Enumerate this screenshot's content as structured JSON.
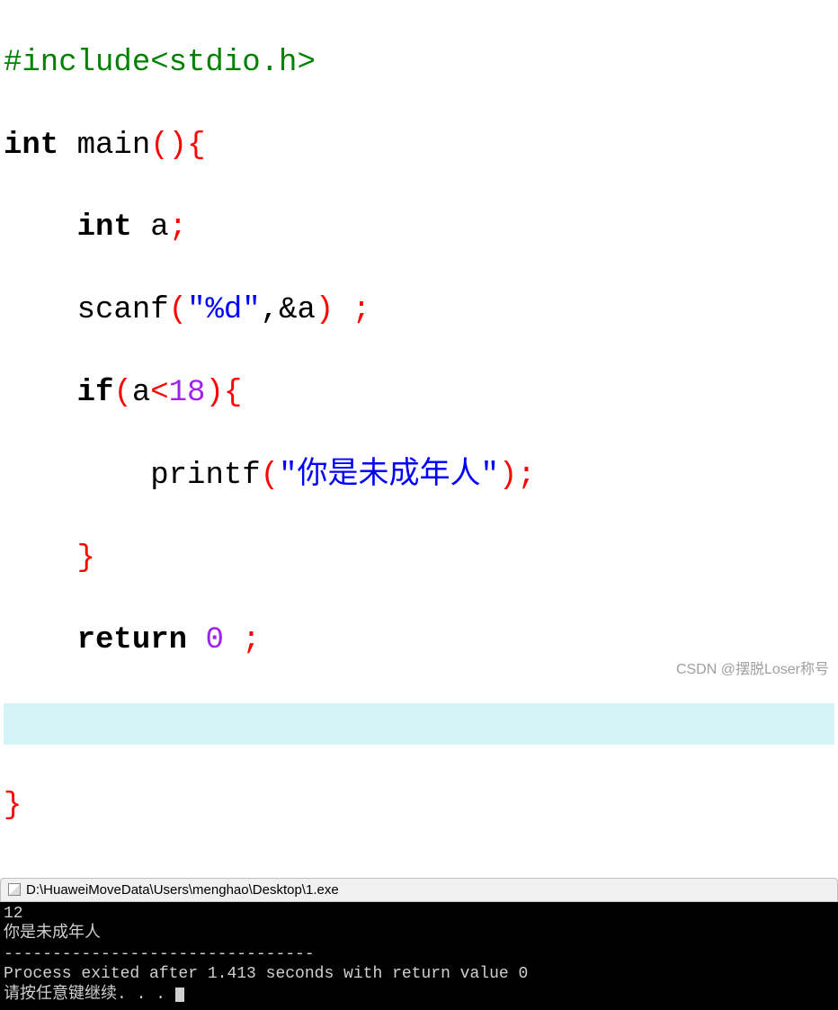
{
  "code": {
    "line1_include": "#include<stdio.h>",
    "line2_int": "int",
    "line2_main": " main",
    "line2_op": "()",
    "line2_brace": "{",
    "line3_indent": "    ",
    "line3_int": "int",
    "line3_a": " a",
    "line3_semi": ";",
    "line4_indent": "    ",
    "line4_scanf": "scanf",
    "line4_op1": "(",
    "line4_str": "\"%d\"",
    "line4_comma": ",",
    "line4_amp": "&a",
    "line4_op2": ")",
    "line4_space": " ",
    "line4_semi": ";",
    "line5_indent": "    ",
    "line5_if": "if",
    "line5_op1": "(",
    "line5_a": "a",
    "line5_lt": "<",
    "line5_num": "18",
    "line5_op2": ")",
    "line5_brace": "{",
    "line6_indent": "        ",
    "line6_printf": "printf",
    "line6_op1": "(",
    "line6_str": "\"你是未成年人\"",
    "line6_op2": ")",
    "line6_semi": ";",
    "line7_indent": "    ",
    "line7_brace": "}",
    "line8_indent": "    ",
    "line8_return": "return",
    "line8_space1": " ",
    "line8_zero": "0",
    "line8_space2": " ",
    "line8_semi": ";",
    "line9_brace": "}"
  },
  "console": {
    "title": "D:\\HuaweiMoveData\\Users\\menghao\\Desktop\\1.exe",
    "line1": "12",
    "line2": "你是未成年人",
    "line3": "--------------------------------",
    "line4": "Process exited after 1.413 seconds with return value 0",
    "line5": "请按任意键继续. . . "
  },
  "watermark": "CSDN @摆脱Loser称号"
}
